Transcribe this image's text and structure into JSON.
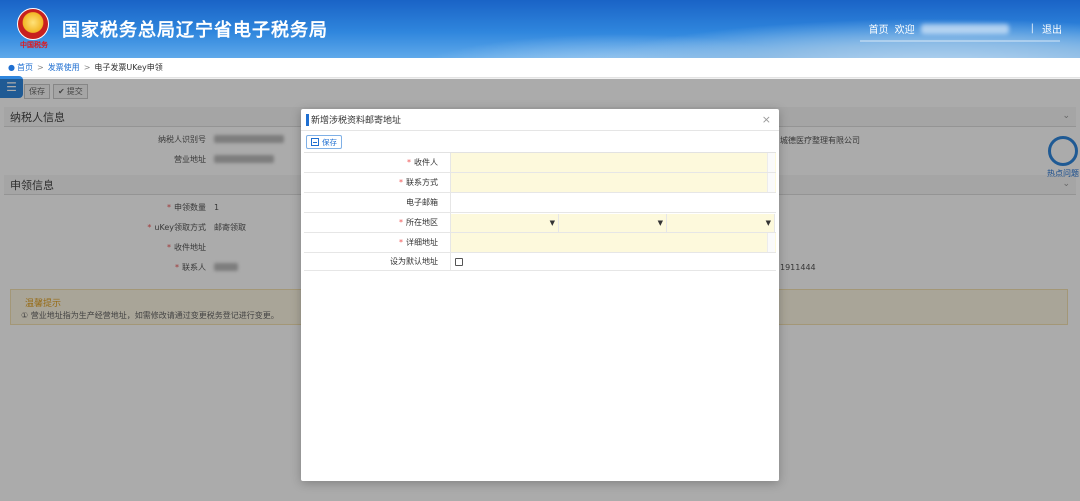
{
  "header": {
    "site_title": "国家税务总局辽宁省电子税务局",
    "logo_text": "中国税务",
    "nav_home": "首页",
    "nav_welcome": "欢迎",
    "nav_divider": "|",
    "nav_logout": "退出"
  },
  "breadcrumb": {
    "home": "首页",
    "sep": ">",
    "parent": "发票使用",
    "current": "电子发票UKey申领"
  },
  "background": {
    "toolbar": {
      "save": "保存",
      "submit": "提交"
    },
    "section1": "纳税人信息",
    "rows1": [
      {
        "label": "纳税人识别号"
      },
      {
        "label": "营业地址"
      }
    ],
    "company_suffix": "城德医疗整理有限公司",
    "section2": "申领信息",
    "rows2": [
      {
        "label": "申领数量",
        "value": "1"
      },
      {
        "label": "uKey领取方式",
        "value": "邮寄领取"
      },
      {
        "label": "收件地址",
        "value": ""
      },
      {
        "label": "联系人",
        "value": ""
      }
    ],
    "phone_suffix": "1911444",
    "tip_title": "温馨提示",
    "tip_text": "① 营业地址指为生产经营地址，如需修改请通过变更税务登记进行变更。",
    "help_label": "热点问题"
  },
  "modal": {
    "title": "新增涉税资料邮寄地址",
    "close": "×",
    "save_label": "保存",
    "fields": [
      {
        "label": "收件人",
        "required": "*",
        "value": ""
      },
      {
        "label": "联系方式",
        "required": "*",
        "value": ""
      },
      {
        "label": "电子邮箱",
        "required": "",
        "value": ""
      },
      {
        "label": "所在地区",
        "required": "*",
        "value": ""
      },
      {
        "label": "详细地址",
        "required": "*",
        "value": ""
      },
      {
        "label": "设为默认地址",
        "required": "",
        "value": ""
      }
    ]
  },
  "colors": {
    "brand_blue": "#1f6fd1",
    "required_red": "#e55555",
    "field_yellow": "#fdf9dc"
  }
}
